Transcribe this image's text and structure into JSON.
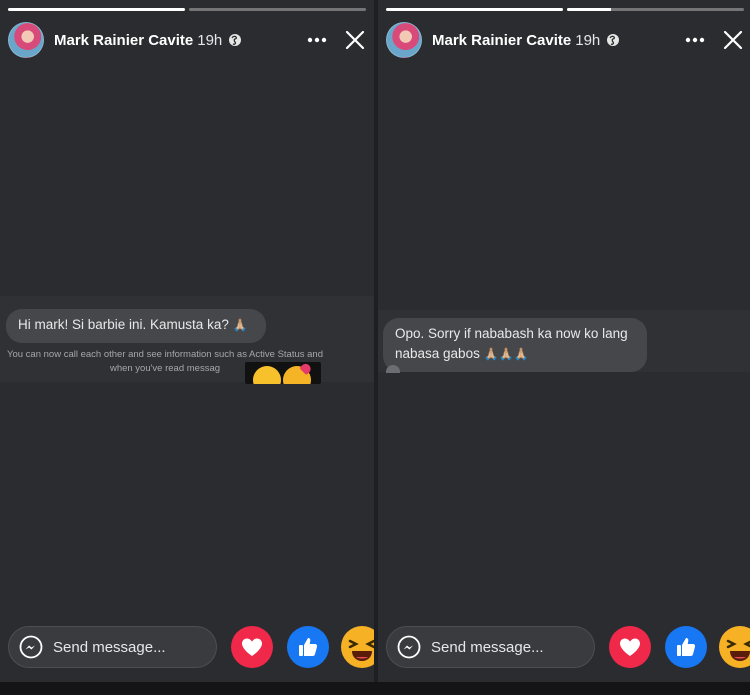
{
  "stories": [
    {
      "progress": [
        1.0,
        0.0
      ],
      "author_name": "Mark Rainier Cavite",
      "time": "19h",
      "message": "Hi mark! Si barbie ini. Kamusta ka?",
      "message_emoji": "🙏🏼",
      "notice": "You can now call each other and see information such as Active Status and when you've read messag"
    },
    {
      "progress": [
        1.0,
        0.25
      ],
      "author_name": "Mark Rainier Cavite",
      "time": "19h",
      "message": "Opo. Sorry if nababash ka now ko lang nabasa gabos",
      "message_emoji": "🙏🏼🙏🏼🙏🏼"
    }
  ],
  "reply_placeholder": "Send message...",
  "icons": {
    "globe": "globe-icon",
    "more": "more-options-icon",
    "close": "close-icon",
    "messenger": "messenger-icon",
    "reactions": [
      "love-reaction-icon",
      "like-reaction-icon",
      "haha-reaction-icon"
    ]
  },
  "colors": {
    "love": "#f0284a",
    "like": "#1877f2",
    "haha": "#f7b125"
  }
}
